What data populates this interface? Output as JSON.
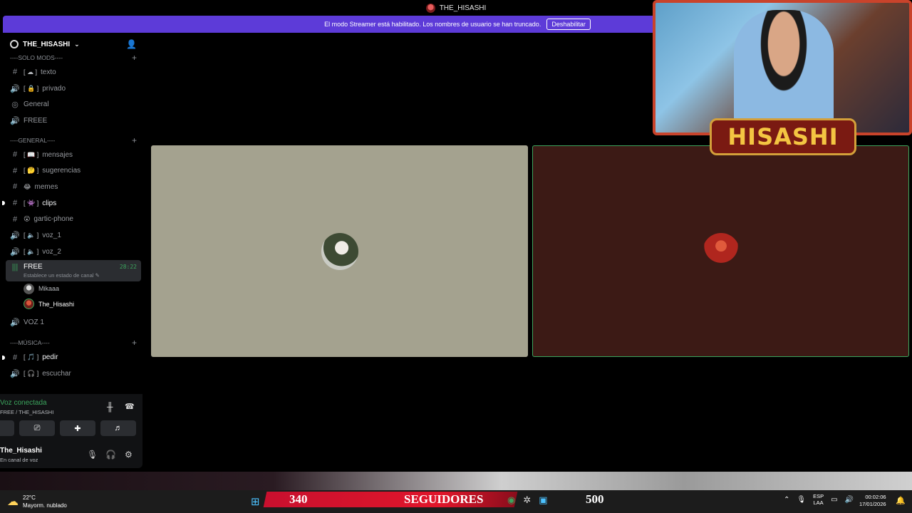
{
  "window": {
    "title": "THE_HISASHI"
  },
  "banner": {
    "text": "El modo Streamer está habilitado. Los nombres de usuario se han truncado.",
    "button": "Deshabilitar"
  },
  "server": {
    "name": "THE_HISASHI"
  },
  "categories": {
    "solo_mods": "----SOLO MODS----",
    "general": "----GENERAL----",
    "musica": "----MÚSICA----"
  },
  "channels": {
    "texto": {
      "emoji": "[ ☁ ]",
      "label": "texto"
    },
    "privado": {
      "emoji": "[ 🔒 ]",
      "label": "privado"
    },
    "general_voice": {
      "label": "General"
    },
    "freee": {
      "label": "FREEE"
    },
    "mensajes": {
      "emoji": "[ 📖 ]",
      "label": "mensajes"
    },
    "sugerencias": {
      "emoji": "[ 🤔 ]",
      "label": "sugerencias"
    },
    "memes": {
      "emoji": "😂",
      "label": "memes"
    },
    "clips": {
      "emoji": "[ 👾 ]",
      "label": "clips"
    },
    "gartic": {
      "emoji": "😮",
      "label": "gartic-phone"
    },
    "voz_1": {
      "emoji": "[ 🔈 ]",
      "label": "voz_1"
    },
    "voz_2": {
      "emoji": "[ 🔈 ]",
      "label": "voz_2"
    },
    "free_active": {
      "label": "FREE",
      "timer": "28:22",
      "status": "Establece un estado de canal ✎"
    },
    "voz1": {
      "label": "VOZ 1"
    },
    "pedir": {
      "emoji": "[ 🎵 ]",
      "label": "pedir"
    },
    "escuchar": {
      "emoji": "[ 🎧 ]",
      "label": "escuchar"
    }
  },
  "voice_users": [
    {
      "name": "Mikaaa"
    },
    {
      "name": "The_Hisashi"
    }
  ],
  "voice_panel": {
    "connected": "Voz conectada",
    "location": "FREE / THE_HISASHI",
    "username": "The_Hisashi",
    "user_status": "En canal de voz"
  },
  "overlay": {
    "name": "HISASHI"
  },
  "taskbar": {
    "temp": "22°C",
    "weather": "Mayorm. nublado",
    "followers_count": "340",
    "followers_label": "SEGUIDORES",
    "goal": "500",
    "lang1": "ESP",
    "lang2": "LAA",
    "time": "00:02:06",
    "date": "17/01/2026"
  },
  "colors": {
    "accent": "#5d3bd8",
    "voice_green": "#3ba55d",
    "overlay_red": "#c9432b"
  }
}
